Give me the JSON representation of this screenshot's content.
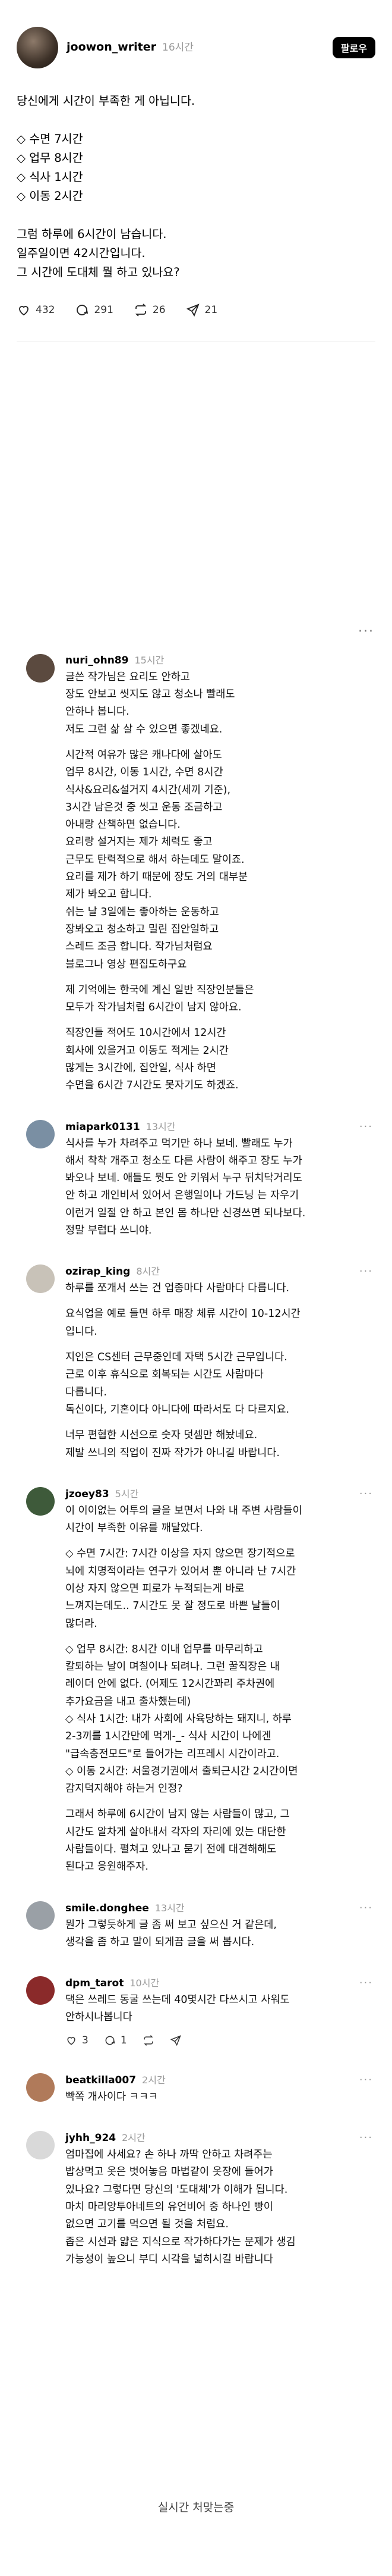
{
  "post": {
    "username": "joowon_writer",
    "time": "16시간",
    "follow_label": "팔로우",
    "lines": [
      "당신에게 시간이 부족한 게 아닙니다.",
      "",
      "◇ 수면 7시간",
      "◇ 업무 8시간",
      "◇ 식사 1시간",
      "◇ 이동 2시간",
      "",
      "그럼 하루에 6시간이 남습니다.",
      "일주일이면 42시간입니다.",
      "그 시간에 도대체 뭘 하고 있나요?"
    ],
    "actions": {
      "likes": "432",
      "comments": "291",
      "reposts": "26",
      "shares": "21"
    },
    "icons": [
      "heart-icon",
      "comment-icon",
      "repost-icon",
      "share-icon"
    ]
  },
  "comments": [
    {
      "username": "nuri_ohn89",
      "time": "15시간",
      "avatar_color": "#5b4a3f",
      "paragraphs": [
        [
          "글쓴 작가님은 요리도 안하고",
          "장도 안보고 씻지도 않고 청소나 빨래도",
          "안하나 봅니다.",
          "저도 그런 삶 살 수 있으면 좋겠네요."
        ],
        [
          "시간적 여유가 많은 캐나다에 살아도",
          "업무 8시간, 이동 1시간, 수면 8시간",
          "식사&요리&설거지 4시간(세끼 기준),",
          "3시간 남은것 중 씻고 운동 조금하고",
          "아내랑 산책하면 없습니다.",
          "요리랑 설거지는 제가 체력도 좋고",
          "근무도 탄력적으로 해서 하는데도 말이죠.",
          "요리를 제가 하기 때문에 장도 거의 대부분",
          "제가 봐오고 합니다.",
          "쉬는 날 3일에는 좋아하는 운동하고",
          "장봐오고 청소하고 밀린 집안일하고",
          "스레드 조금 합니다. 작가님처럼요",
          "블로그나 영상 편집도하구요"
        ],
        [
          "제 기억에는 한국에 계신 일반 직장인분들은",
          "모두가 작가님처럼 6시간이 남지 않아요."
        ],
        [
          "직장인들 적어도 10시간에서 12시간",
          "회사에 있을거고 이동도 적게는 2시간",
          "많게는 3시간에, 집안일, 식사 하면",
          "수면을 6시간 7시간도 못자기도 하겠죠."
        ]
      ]
    },
    {
      "username": "miapark0131",
      "time": "13시간",
      "avatar_color": "#7a8fa3",
      "paragraphs": [
        [
          "식사를 누가 차려주고 먹기만 하나 보네. 빨래도 누가",
          "해서 착착 개주고 청소도 다른 사람이 해주고 장도 누가",
          "봐오나 보네. 애들도 뭣도 안 키워서 누구 뒤치닥거리도",
          "안 하고 개인비서 있어서 은행일이나 가드닝 는 자우기",
          "이런거 일절 안 하고 본인 몸 하나만 신경쓰면 되나보다.",
          "정말 부럽다 쓰니야."
        ]
      ]
    },
    {
      "username": "ozirap_king",
      "time": "8시간",
      "avatar_color": "#c8c2b8",
      "paragraphs": [
        [
          "하루를 쪼개서 쓰는 건 업종마다 사람마다 다릅니다."
        ],
        [
          "요식업을 예로 들면 하루 매장 체류 시간이 10-12시간",
          "입니다."
        ],
        [
          "지인은 CS센터 근무중인데 자택 5시간 근무입니다.",
          "근로 이후 휴식으로 회복되는 시간도 사람마다",
          "다릅니다.",
          "독신이다, 기혼이다 아니다에 따라서도 다 다르지요."
        ],
        [
          "너무 편협한 시선으로 숫자 덧셈만 해놨네요.",
          "제발 쓰니의 직업이 진짜 작가가 아니길 바랍니다."
        ]
      ]
    },
    {
      "username": "jzoey83",
      "time": "5시간",
      "avatar_color": "#3e5a3a",
      "paragraphs": [
        [
          "이 이이없는 어투의 글을 보면서 나와 내 주변 사람들이",
          "시간이 부족한 이유를 깨달았다."
        ],
        [
          "◇ 수면 7시간: 7시간 이상을 자지 않으면 장기적으로",
          "뇌에 치명적이라는 연구가 있어서 뿐 아니라 난 7시간",
          "이상 자지 않으면 피로가 누적되는게 바로",
          "느껴지는데도.. 7시간도 못 잘 정도로 바쁜 날들이",
          "많더라."
        ],
        [
          "◇ 업무 8시간: 8시간 이내 업무를 마무리하고",
          "칼퇴하는 날이 며칠이나 되려나. 그런 꿀직장은 내",
          "레이더 안에 없다. (어제도 12시간꽈리 주차권에",
          "추가요금을 내고 출차했는데)",
          "◇ 식사 1시간: 내가 사회에 사육당하는 돼지니, 하루",
          "2-3끼를 1시간만에 먹게-_- 식사 시간이 나에겐",
          "\"급속충전모드\"로 들어가는 리프레시 시간이라고.",
          "◇ 이동 2시간: 서울경기권에서 출퇴근시간 2시간이면",
          "감지덕지해야 하는거 인정?"
        ],
        [
          "그래서 하루에 6시간이 남지 않는 사람들이 많고, 그",
          "시간도 알차게 살아내서 각자의 자리에 있는 대단한",
          "사람들이다. 펼쳐고 있나고 묻기 전에 대견해해도",
          "된다고 응원해주자."
        ]
      ]
    },
    {
      "username": "smile.donghee",
      "time": "13시간",
      "avatar_color": "#9aa0a6",
      "paragraphs": [
        [
          "뭔가 그렇듯하게 글 좀 써 보고 싶으신 거 같은데,",
          "생각을 좀 하고 말이 되게끔 글을 써 봅시다."
        ]
      ]
    },
    {
      "username": "dpm_tarot",
      "time": "10시간",
      "avatar_color": "#8a2a2a",
      "paragraphs": [
        [
          "댁은 쓰레드 동굴 쓰는데 40몇시간 다쓰시고 사워도",
          "안하시나봅니다"
        ]
      ],
      "actions": {
        "likes": "3",
        "comments": "1",
        "reposts": "",
        "shares": ""
      }
    },
    {
      "username": "beatkilla007",
      "time": "2시간",
      "avatar_color": "#b07a5a",
      "paragraphs": [
        [
          "빡쪽 개사이다 ㅋㅋㅋ"
        ]
      ]
    },
    {
      "username": "jyhh_924",
      "time": "2시간",
      "avatar_color": "#d9d9d9",
      "paragraphs": [
        [
          "엄마집에 사세요? 손 하나 까딱 안하고 차려주는",
          "밥상먹고 옷은 벗어놓음 마법같이 옷장에 들어가",
          "있나요? 그렇다면 당신의 '도대체'가 이해가 됩니다.",
          "마치 마리앙투아네트의 유언비어 중 하나인 빵이",
          "없으면 고기를 먹으면 될 것을 처럼요.",
          "좁은 시선과 얇은 지식으로 작가하다가는 문제가 생김",
          "가능성이 높으니 부디 시각을 넓히시길 바랍니다"
        ]
      ]
    }
  ],
  "footer": {
    "status": "실시간 처맞는중"
  }
}
